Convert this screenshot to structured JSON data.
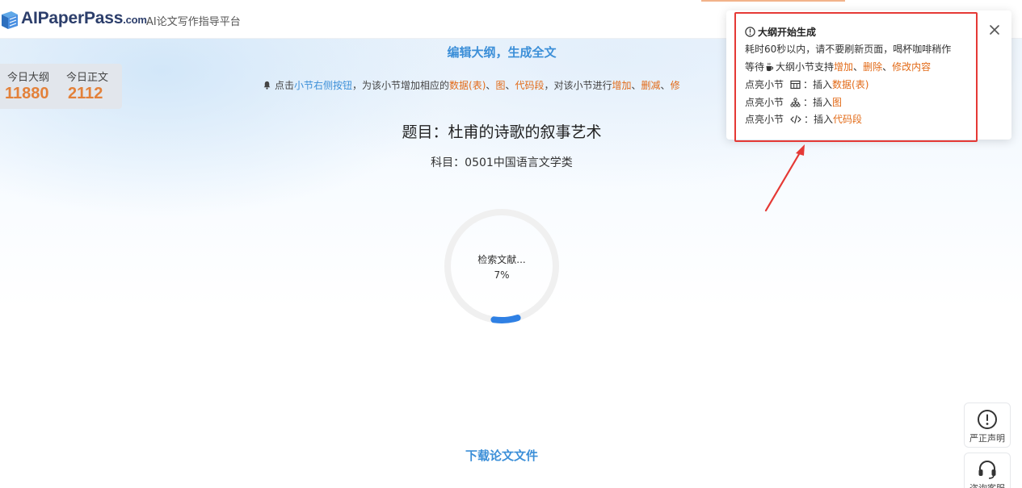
{
  "header": {
    "logo_main": "AIPaperPass",
    "logo_suffix": ".com",
    "tagline": "AI论文写作指导平台"
  },
  "stats": {
    "outline_label": "今日大纲",
    "outline_value": "11880",
    "text_label": "今日正文",
    "text_value": "2112"
  },
  "main": {
    "section_title": "编辑大纲，生成全文",
    "notice": {
      "p1": "点击",
      "p2": "小节右侧按钮",
      "p3": "，为该小节增加相应的",
      "p4": "数据(表)",
      "p5": "、",
      "p6": "图",
      "p7": "、",
      "p8": "代码段",
      "p9": "，对该小节进行",
      "p10": "增加",
      "p11": "、",
      "p12": "删减",
      "p13": "、",
      "p14": "修"
    },
    "paper_title": "题目：杜甫的诗歌的叙事艺术",
    "subject": "科目：0501中国语言文学类",
    "progress": {
      "label": "检索文献...",
      "percent_text": "7%",
      "value": 0.07
    },
    "download_label": "下载论文文件"
  },
  "side_buttons": {
    "disclaimer_label": "严正声明",
    "service_label": "咨询客服"
  },
  "toast": {
    "title": "大纲开始生成",
    "line1": "耗时60秒以内，请不要刷新页面，喝杯咖啡稍作",
    "line2_a": "等待",
    "line2_b": "大纲小节支持",
    "line2_c": "增加",
    "line2_d": "、",
    "line2_e": "删除",
    "line2_f": "、",
    "line2_g": "修改内容",
    "line3_a": "点亮小节",
    "line3_b": "：插入",
    "line3_c": "数据(表)",
    "line4_a": "点亮小节",
    "line4_b": "：插入",
    "line4_c": "图",
    "line5_a": "点亮小节",
    "line5_b": "：插入",
    "line5_c": "代码段"
  },
  "colors": {
    "accent_blue": "#3c8fd8",
    "accent_orange": "#e26a17",
    "stat_orange": "#e3813a",
    "highlight_red": "#e53935",
    "progress_blue": "#2f80e4"
  }
}
